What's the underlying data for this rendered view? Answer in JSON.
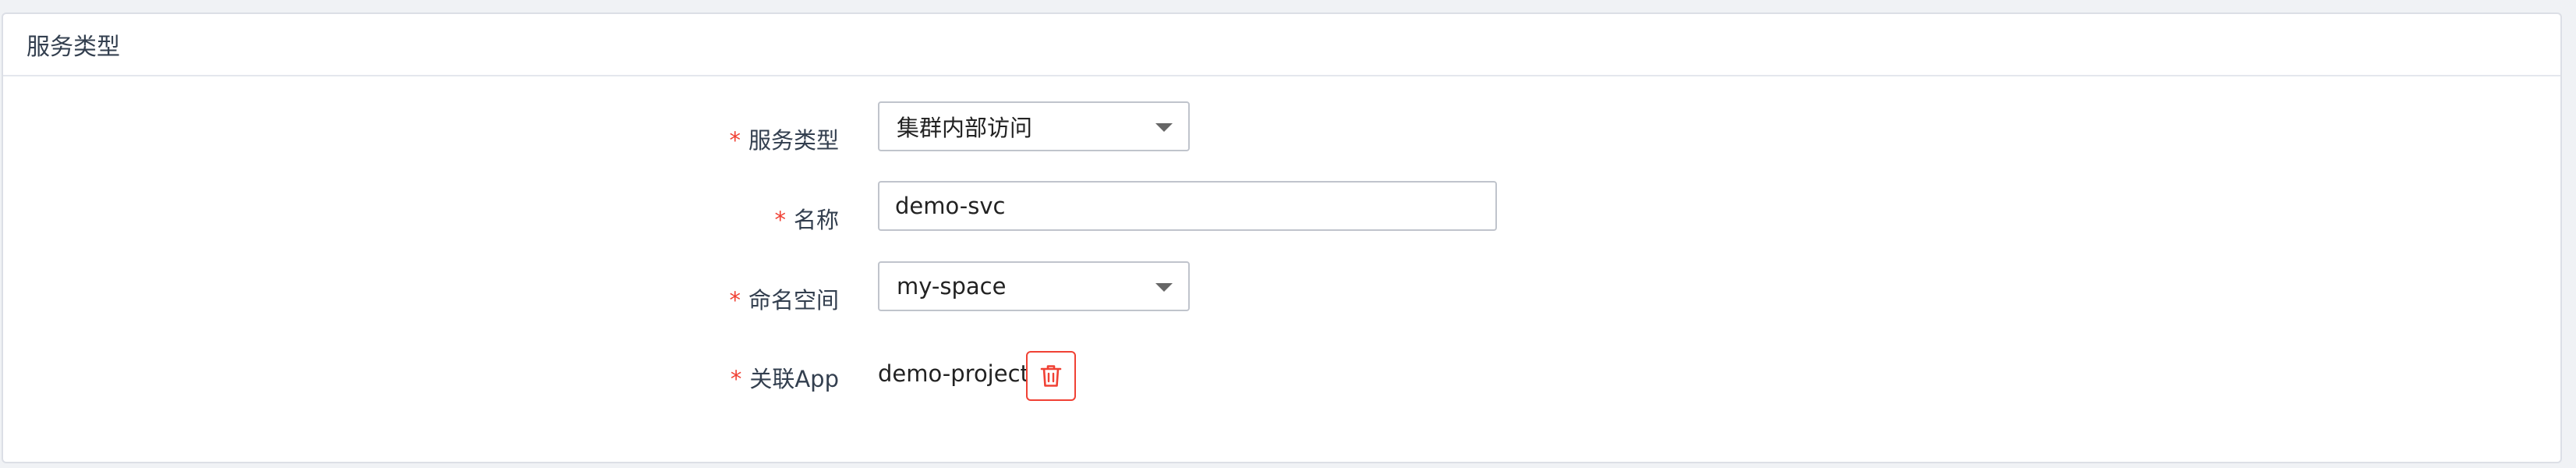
{
  "panel": {
    "title": "服务类型"
  },
  "form": {
    "required_mark": "*",
    "service_type": {
      "label": "服务类型",
      "value": "集群内部访问"
    },
    "name": {
      "label": "名称",
      "value": "demo-svc"
    },
    "namespace": {
      "label": "命名空间",
      "value": "my-space"
    },
    "related_app": {
      "label": "关联App",
      "value": "demo-project",
      "delete_icon": "trash-icon"
    }
  },
  "colors": {
    "required": "#f04134",
    "delete_border": "#f04134",
    "label": "#333f4f",
    "border": "#c0c4cc"
  }
}
